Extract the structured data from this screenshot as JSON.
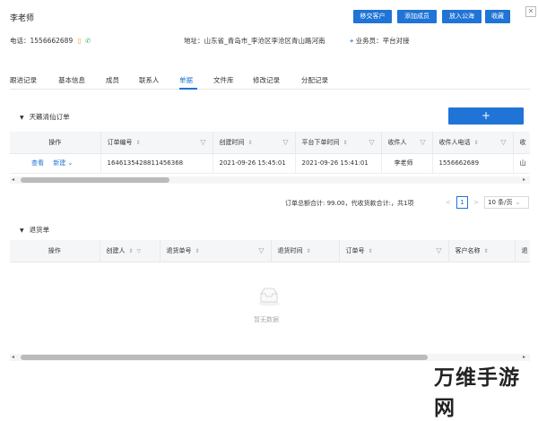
{
  "header": {
    "name": "李老师",
    "phone_label": "电话：",
    "phone": "1556662689",
    "address_label": "地址：",
    "address": "山东省_青岛市_李沧区李沧区青山路河南",
    "salesperson_label": "业务员：",
    "salesperson": "平台对接",
    "buttons": [
      "移交客户",
      "添加成员",
      "放入公海",
      "收藏"
    ]
  },
  "tabs": [
    "跟进记录",
    "基本信息",
    "成员",
    "联系人",
    "单据",
    "文件库",
    "修改记录",
    "分配记录"
  ],
  "active_tab": "单据",
  "orders": {
    "title": "天籁清仙订单",
    "add_label": "+",
    "columns": [
      "操作",
      "订单编号",
      "创建时间",
      "平台下单时间",
      "收件人",
      "收件人电话",
      "收"
    ],
    "rows": [
      {
        "actions": [
          "查看",
          "新建"
        ],
        "order_no": "1646135428811456368",
        "created": "2021-09-26 15:45:01",
        "platform_time": "2021-09-26 15:41:01",
        "recipient": "李老师",
        "phone": "1556662689",
        "extra": "山"
      }
    ]
  },
  "pagination": {
    "summary": "订单总额合计: 99.00，代收货款合计:，共1项",
    "prev": "<",
    "current": "1",
    "next": ">",
    "page_size": "10 条/页"
  },
  "returns": {
    "title": "退货单",
    "columns": [
      "操作",
      "创建人",
      "退货单号",
      "退货时间",
      "订单号",
      "客户名称",
      "退"
    ],
    "empty_text": "暂无数据"
  },
  "watermark": "万维手游网",
  "colors": {
    "accent": "#1f74d6"
  }
}
